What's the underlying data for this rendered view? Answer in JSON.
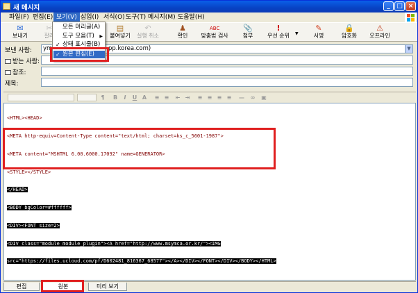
{
  "window": {
    "title": "새 메시지"
  },
  "menubar": {
    "items": [
      "파일(F)",
      "편집(E)",
      "보기(V)",
      "삽입(I)",
      "서식(O)",
      "도구(T)",
      "메시지(M)",
      "도움말(H)"
    ]
  },
  "view_menu": {
    "items": [
      {
        "label": "모든 머리글(A)",
        "checked": false,
        "submenu": false
      },
      {
        "label": "도구 모음(T)",
        "checked": false,
        "submenu": true
      },
      {
        "label": "상태 표시줄(B)",
        "checked": true,
        "submenu": false
      },
      {
        "label": "원본 편집(E)",
        "checked": true,
        "submenu": false,
        "highlighted": true
      }
    ]
  },
  "toolbar": {
    "buttons": [
      {
        "label": "보내기",
        "icon": "send-icon",
        "enabled": true
      },
      {
        "label": "잘라",
        "icon": "cut-icon",
        "enabled": false
      },
      {
        "label": "붙여넣기",
        "icon": "paste-icon",
        "enabled": true
      },
      {
        "label": "실행 취소",
        "icon": "undo-icon",
        "enabled": false
      },
      {
        "label": "확인",
        "icon": "check-names-icon",
        "enabled": true
      },
      {
        "label": "맞춤법 검사",
        "icon": "spelling-icon",
        "enabled": true
      },
      {
        "label": "첨부",
        "icon": "attach-icon",
        "enabled": true
      },
      {
        "label": "우선 순위",
        "icon": "priority-icon",
        "enabled": true
      },
      {
        "label": "서명",
        "icon": "sign-icon",
        "enabled": true
      },
      {
        "label": "암호화",
        "icon": "encrypt-icon",
        "enabled": true
      },
      {
        "label": "오프라인",
        "icon": "offline-icon",
        "enabled": true
      }
    ]
  },
  "header": {
    "from_label": "보낸 사람:",
    "from_value_start": "ymc",
    "from_value_end": "pp.korea.com)",
    "to_label": "받는 사람:",
    "cc_label": "참조:",
    "subject_label": "제목:"
  },
  "code_lines": [
    {
      "text": "<HTML><HEAD>",
      "highlight": false
    },
    {
      "text": "<META http-equiv=Content-Type content=\"text/html; charset=ks_c_5601-1987\">",
      "highlight": false
    },
    {
      "text": "<META content=\"MSHTML 6.00.6000.17092\" name=GENERATOR>",
      "highlight": false
    },
    {
      "text": "<STYLE></STYLE>",
      "highlight": false
    },
    {
      "text": "</HEAD>",
      "highlight": true
    },
    {
      "text": "<BODY bgColor=#ffffff>",
      "highlight": true
    },
    {
      "text": "<DIV><FONT size=2>",
      "highlight": true
    },
    {
      "text": "<DIV class=\"module module_plugin\"><A href=\"http://www.msymca.or.kr/\"><IMG",
      "highlight": true
    },
    {
      "text": "src=\"https://files.ucloud.com/pf/D602481_816367_68577\"></A></DIV></FONT></DIV></BODY></HTML>",
      "highlight": true
    }
  ],
  "tabs": [
    "편집",
    "원본",
    "미리 보기"
  ],
  "selected_tab": "원본",
  "annotation_color": "#e02020",
  "selection_color": "#316ac5"
}
